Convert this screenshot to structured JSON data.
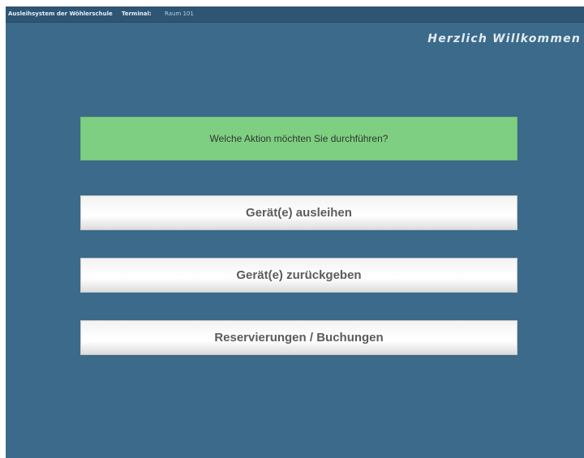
{
  "titlebar": {
    "app_name": "Ausleihsystem der Wöhlerschule",
    "terminal_label": "Terminal:",
    "terminal_value": "Raum 101"
  },
  "header": {
    "welcome": "Herzlich Willkommen"
  },
  "main": {
    "prompt": "Welche Aktion möchten Sie durchführen?",
    "buttons": {
      "borrow": "Gerät(e) ausleihen",
      "return": "Gerät(e) zurückgeben",
      "reservations": "Reservierungen / Buchungen"
    }
  },
  "colors": {
    "background": "#3b6a8a",
    "titlebar": "#2e5573",
    "prompt_box": "#7fcf82",
    "button_text": "#5c5c5c"
  }
}
